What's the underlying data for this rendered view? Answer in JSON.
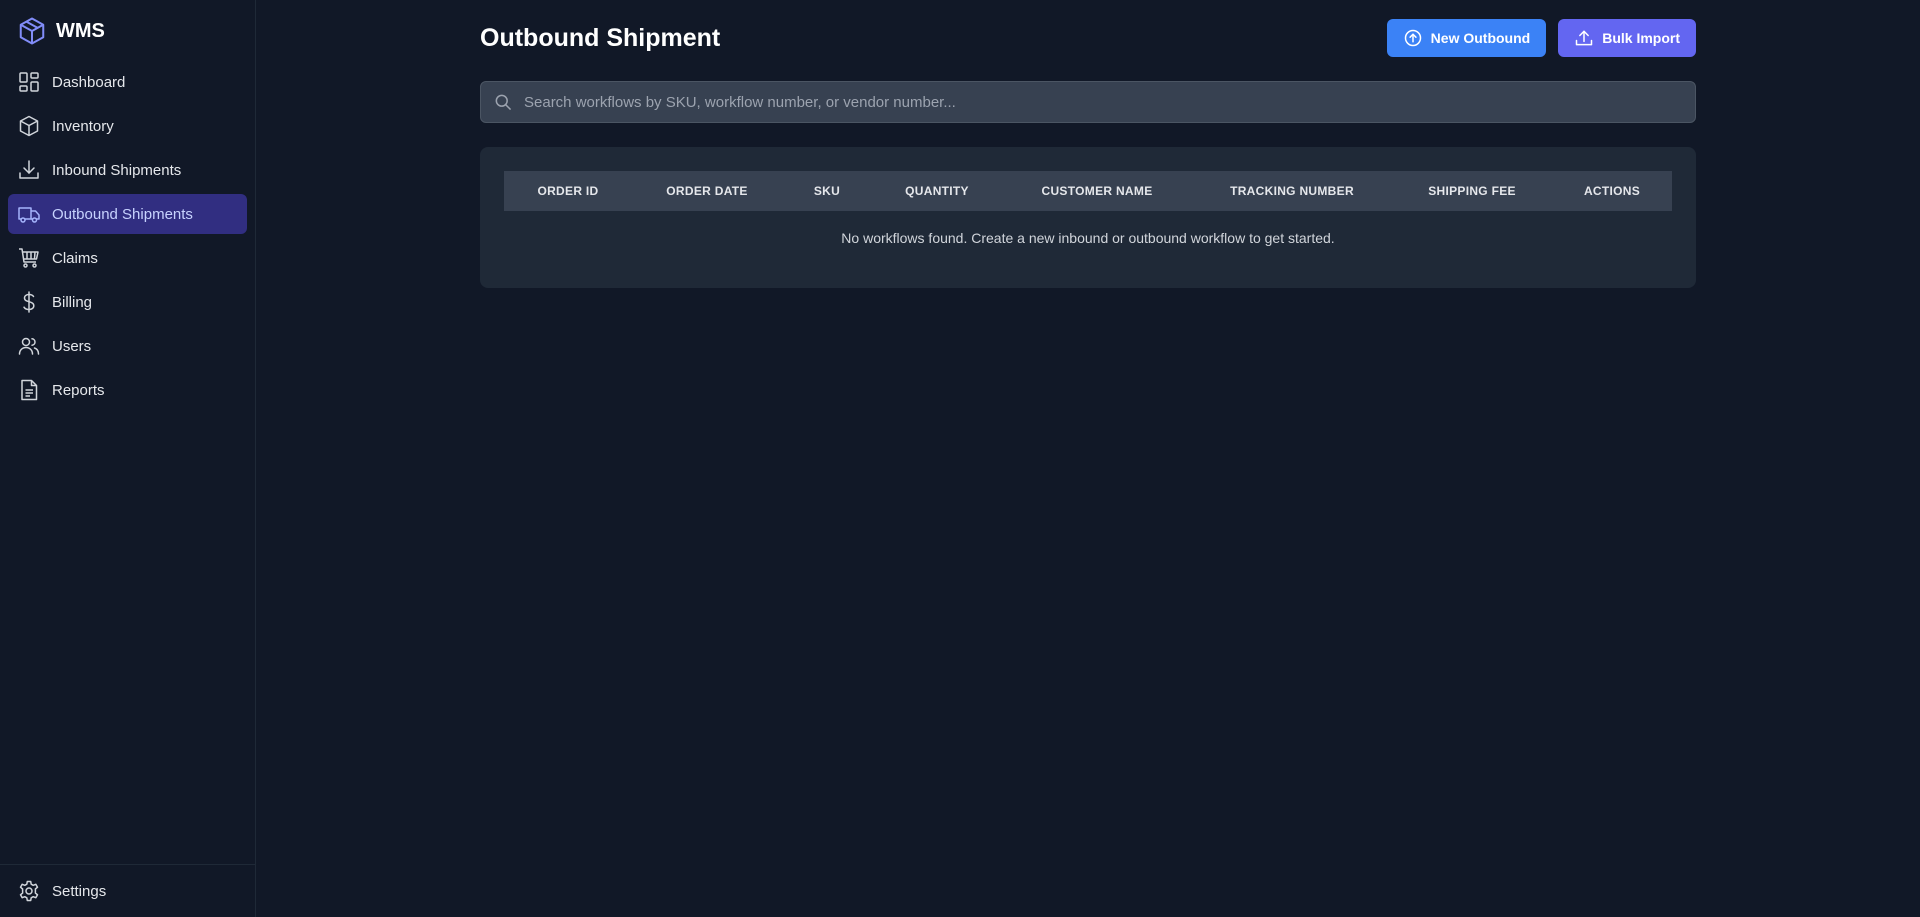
{
  "brand": {
    "name": "WMS"
  },
  "sidebar": {
    "items": [
      {
        "label": "Dashboard",
        "icon": "dashboard-icon",
        "active": false
      },
      {
        "label": "Inventory",
        "icon": "box-icon",
        "active": false
      },
      {
        "label": "Inbound Shipments",
        "icon": "download-icon",
        "active": false
      },
      {
        "label": "Outbound Shipments",
        "icon": "truck-icon",
        "active": true
      },
      {
        "label": "Claims",
        "icon": "cart-icon",
        "active": false
      },
      {
        "label": "Billing",
        "icon": "dollar-icon",
        "active": false
      },
      {
        "label": "Users",
        "icon": "users-icon",
        "active": false
      },
      {
        "label": "Reports",
        "icon": "document-icon",
        "active": false
      }
    ],
    "footer": {
      "label": "Settings",
      "icon": "gear-icon"
    }
  },
  "page": {
    "title": "Outbound Shipment",
    "buttons": {
      "new_outbound": "New Outbound",
      "bulk_import": "Bulk Import"
    }
  },
  "search": {
    "placeholder": "Search workflows by SKU, workflow number, or vendor number...",
    "value": ""
  },
  "table": {
    "columns": [
      "Order ID",
      "Order Date",
      "SKU",
      "Quantity",
      "Customer Name",
      "Tracking Number",
      "Shipping Fee",
      "Actions"
    ],
    "rows": [],
    "empty_message": "No workflows found. Create a new inbound or outbound workflow to get started."
  },
  "colors": {
    "background": "#111827",
    "card": "#1f2937",
    "accent_blue": "#3b82f6",
    "accent_purple": "#6366f1",
    "active_nav": "#312e81"
  }
}
